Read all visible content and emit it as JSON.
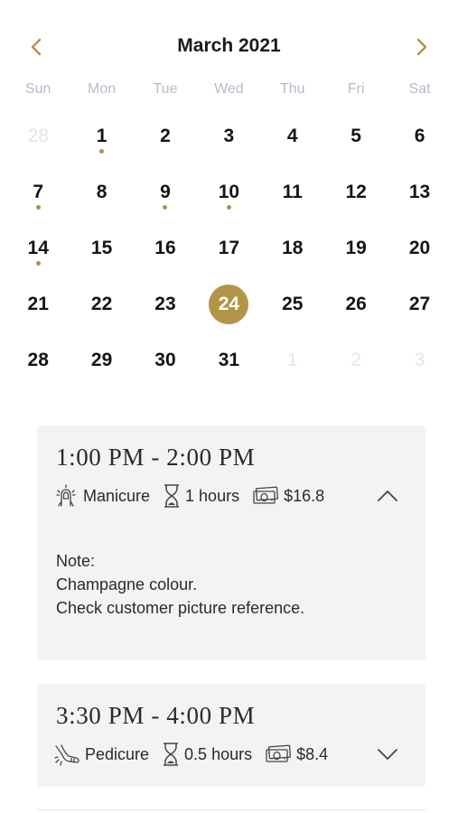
{
  "calendar": {
    "month_label": "March 2021",
    "weekdays": [
      "Sun",
      "Mon",
      "Tue",
      "Wed",
      "Thu",
      "Fri",
      "Sat"
    ],
    "days": [
      {
        "label": "28",
        "muted": true,
        "dot": false,
        "selected": false
      },
      {
        "label": "1",
        "muted": false,
        "dot": true,
        "selected": false
      },
      {
        "label": "2",
        "muted": false,
        "dot": false,
        "selected": false
      },
      {
        "label": "3",
        "muted": false,
        "dot": false,
        "selected": false
      },
      {
        "label": "4",
        "muted": false,
        "dot": false,
        "selected": false
      },
      {
        "label": "5",
        "muted": false,
        "dot": false,
        "selected": false
      },
      {
        "label": "6",
        "muted": false,
        "dot": false,
        "selected": false
      },
      {
        "label": "7",
        "muted": false,
        "dot": true,
        "selected": false
      },
      {
        "label": "8",
        "muted": false,
        "dot": false,
        "selected": false
      },
      {
        "label": "9",
        "muted": false,
        "dot": true,
        "selected": false
      },
      {
        "label": "10",
        "muted": false,
        "dot": true,
        "selected": false
      },
      {
        "label": "11",
        "muted": false,
        "dot": false,
        "selected": false
      },
      {
        "label": "12",
        "muted": false,
        "dot": false,
        "selected": false
      },
      {
        "label": "13",
        "muted": false,
        "dot": false,
        "selected": false
      },
      {
        "label": "14",
        "muted": false,
        "dot": true,
        "selected": false
      },
      {
        "label": "15",
        "muted": false,
        "dot": false,
        "selected": false
      },
      {
        "label": "16",
        "muted": false,
        "dot": false,
        "selected": false
      },
      {
        "label": "17",
        "muted": false,
        "dot": false,
        "selected": false
      },
      {
        "label": "18",
        "muted": false,
        "dot": false,
        "selected": false
      },
      {
        "label": "19",
        "muted": false,
        "dot": false,
        "selected": false
      },
      {
        "label": "20",
        "muted": false,
        "dot": false,
        "selected": false
      },
      {
        "label": "21",
        "muted": false,
        "dot": false,
        "selected": false
      },
      {
        "label": "22",
        "muted": false,
        "dot": false,
        "selected": false
      },
      {
        "label": "23",
        "muted": false,
        "dot": false,
        "selected": false
      },
      {
        "label": "24",
        "muted": false,
        "dot": false,
        "selected": true
      },
      {
        "label": "25",
        "muted": false,
        "dot": false,
        "selected": false
      },
      {
        "label": "26",
        "muted": false,
        "dot": false,
        "selected": false
      },
      {
        "label": "27",
        "muted": false,
        "dot": false,
        "selected": false
      },
      {
        "label": "28",
        "muted": false,
        "dot": false,
        "selected": false
      },
      {
        "label": "29",
        "muted": false,
        "dot": false,
        "selected": false
      },
      {
        "label": "30",
        "muted": false,
        "dot": false,
        "selected": false
      },
      {
        "label": "31",
        "muted": false,
        "dot": false,
        "selected": false
      },
      {
        "label": "1",
        "muted": true,
        "dot": false,
        "selected": false
      },
      {
        "label": "2",
        "muted": true,
        "dot": false,
        "selected": false
      },
      {
        "label": "3",
        "muted": true,
        "dot": false,
        "selected": false
      }
    ]
  },
  "appointments": [
    {
      "time": "1:00 PM - 2:00 PM",
      "service": "Manicure",
      "service_icon": "manicure-icon",
      "duration": "1 hours",
      "price": "$16.8",
      "expanded": true,
      "toggle_icon": "chevron-up-icon",
      "note_label": "Note:",
      "note_lines": [
        "Champagne colour.",
        "Check customer picture reference."
      ]
    },
    {
      "time": "3:30 PM - 4:00 PM",
      "service": "Pedicure",
      "service_icon": "pedicure-icon",
      "duration": "0.5 hours",
      "price": "$8.4",
      "expanded": false,
      "toggle_icon": "chevron-down-icon"
    }
  ],
  "colors": {
    "accent": "#b49548",
    "event_dot": "#b2924a",
    "card_bg": "#f3f3f3",
    "muted_day": "#e3e5e8",
    "weekday_text": "#b5bcc6"
  }
}
